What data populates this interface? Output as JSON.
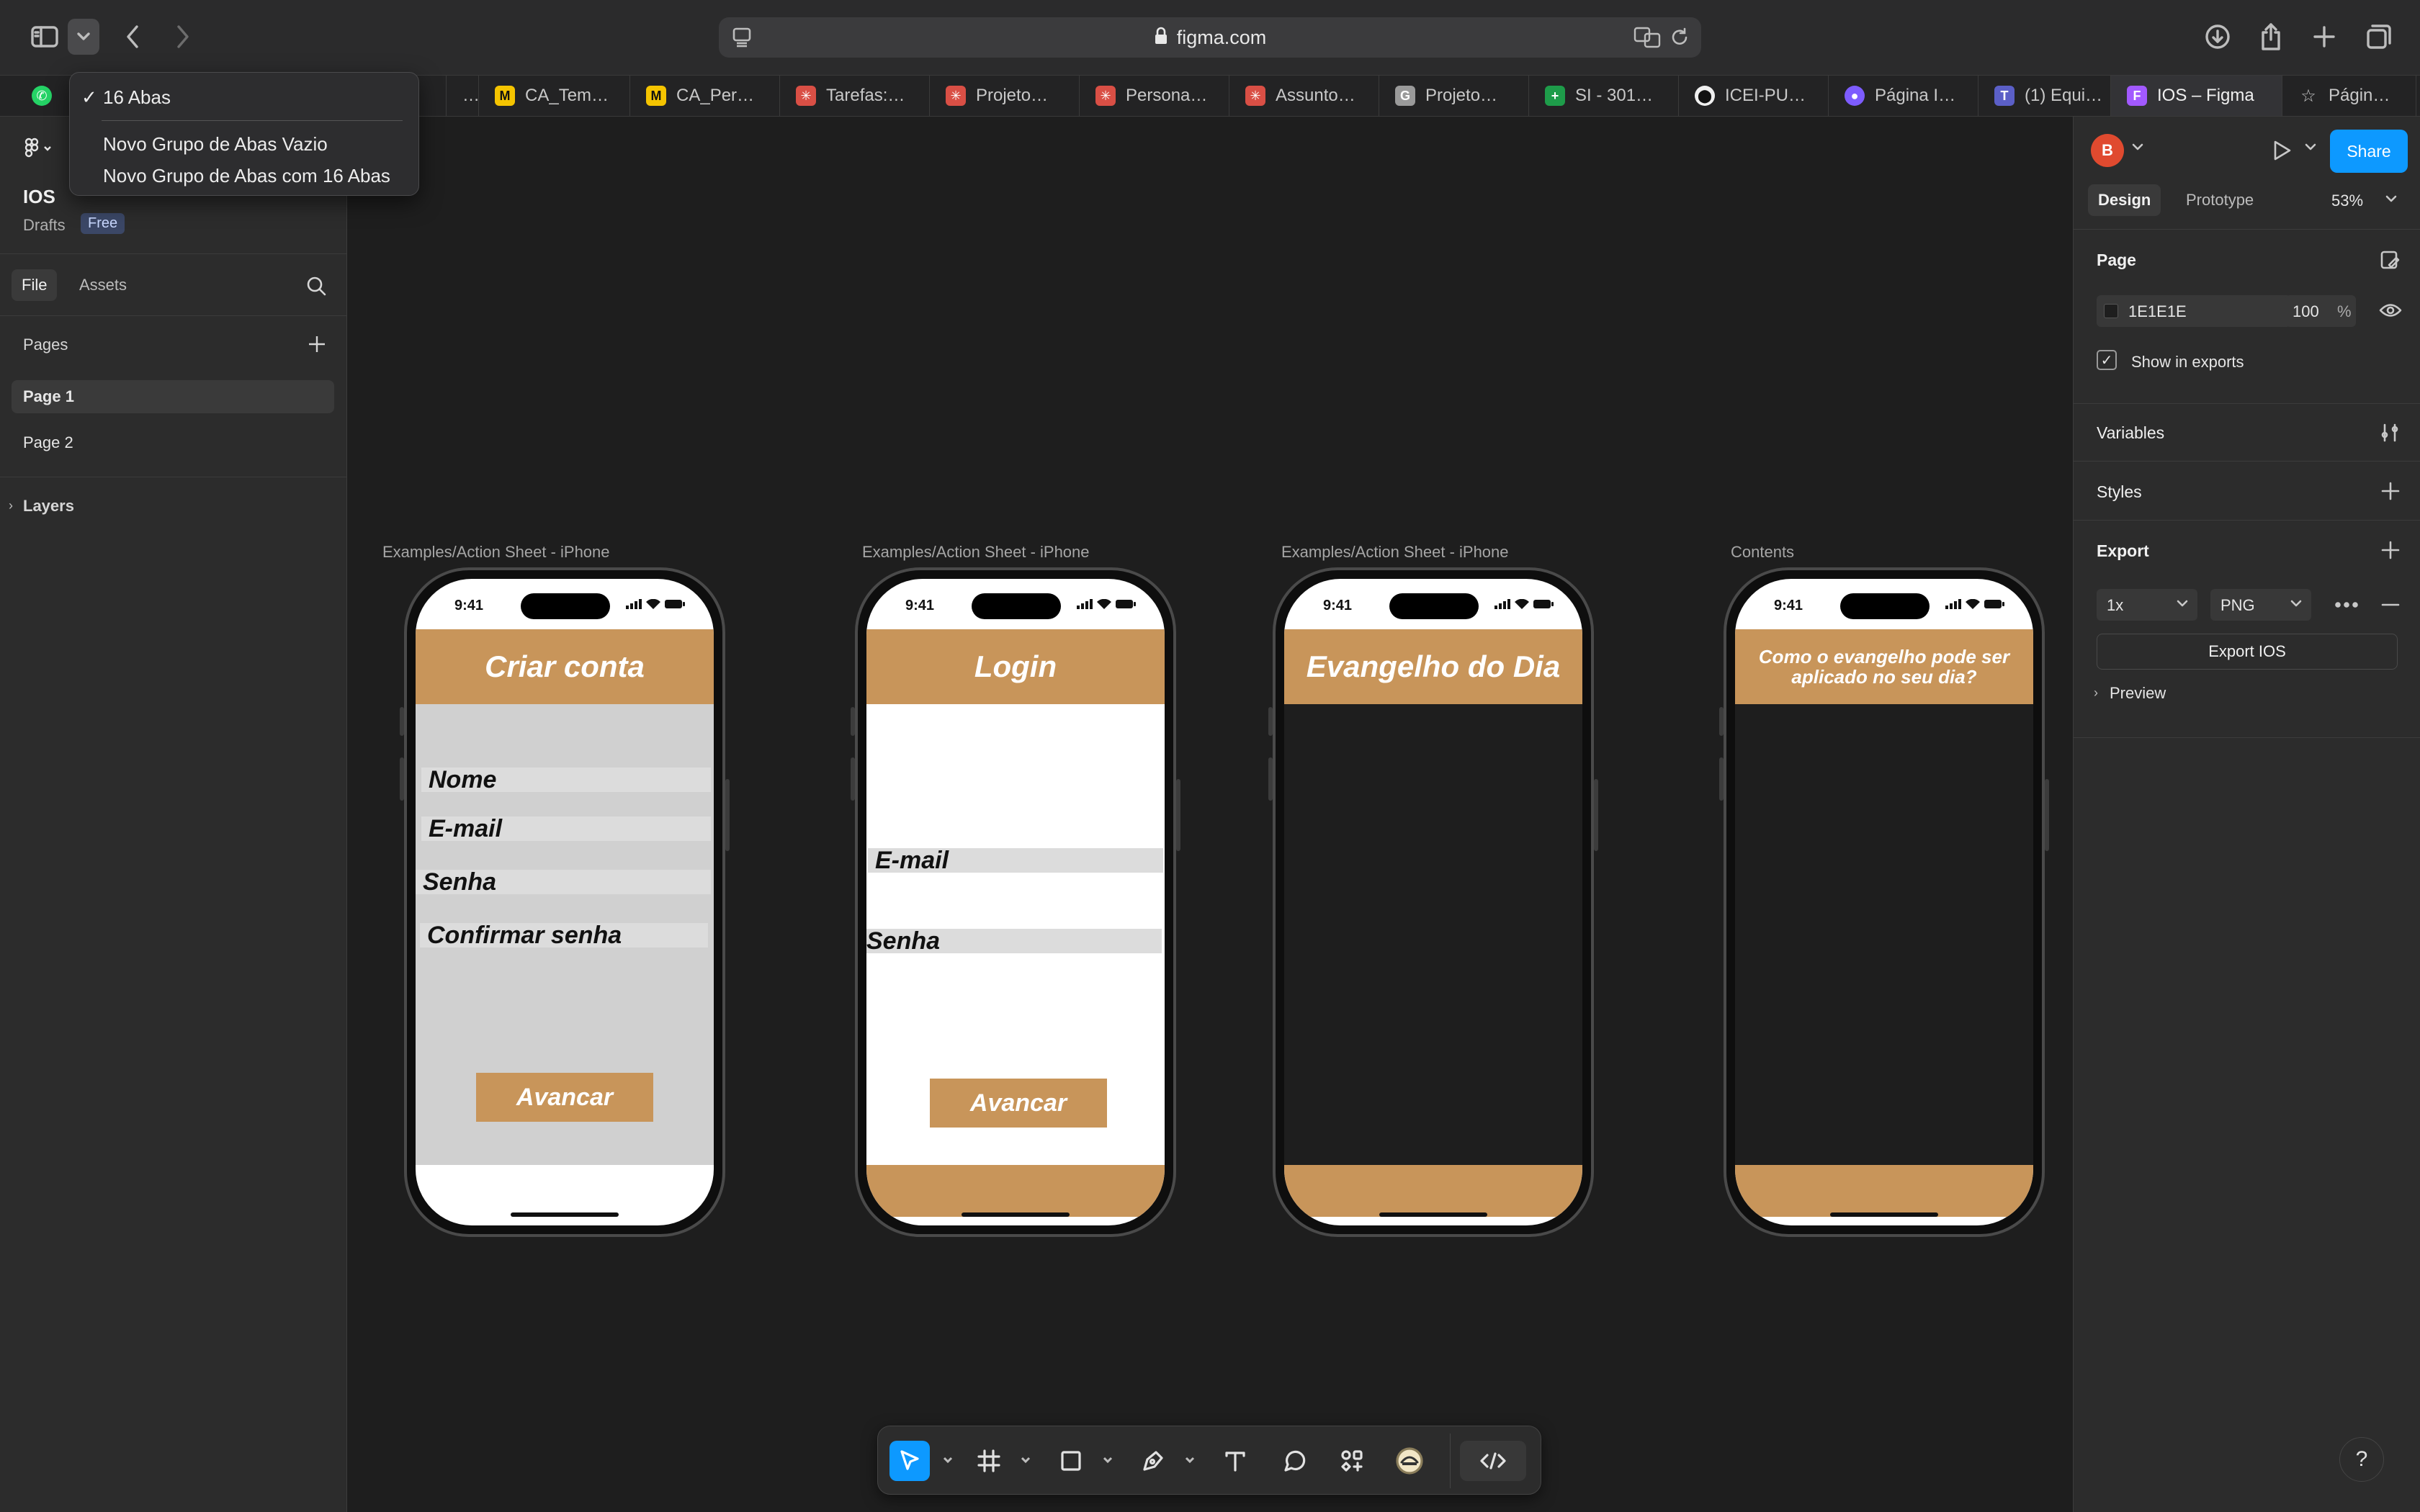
{
  "browser": {
    "url": "figma.com",
    "tabs": [
      {
        "title": "…",
        "fav": "",
        "color": "#2a2a2a"
      },
      {
        "title": "CA_Tem…",
        "fav": "M",
        "color": "#f5c400"
      },
      {
        "title": "CA_Per…",
        "fav": "M",
        "color": "#f5c400"
      },
      {
        "title": "Tarefas:…",
        "fav": "✳",
        "color": "#d94f45"
      },
      {
        "title": "Projeto…",
        "fav": "✳",
        "color": "#d94f45"
      },
      {
        "title": "Persona…",
        "fav": "✳",
        "color": "#d94f45"
      },
      {
        "title": "Assunto…",
        "fav": "✳",
        "color": "#d94f45"
      },
      {
        "title": "Projeto…",
        "fav": "G",
        "color": "#9a9a9a"
      },
      {
        "title": "SI - 301…",
        "fav": "+",
        "color": "#1e9c4a"
      },
      {
        "title": "ICEI-PU…",
        "fav": "⬤",
        "color": "#f0f0f0"
      },
      {
        "title": "Página I…",
        "fav": "●",
        "color": "#7d5cff"
      },
      {
        "title": "(1) Equi…",
        "fav": "T",
        "color": "#5b5fc7"
      },
      {
        "title": "IOS – Figma",
        "fav": "F",
        "color": "#a259ff"
      },
      {
        "title": "Págin…",
        "fav": "☆",
        "color": "#2a2a2a"
      }
    ]
  },
  "tab_menu": {
    "current": "16 Abas",
    "items": [
      "Novo Grupo de Abas Vazio",
      "Novo Grupo de Abas com 16 Abas"
    ]
  },
  "file": {
    "title": "IOS",
    "location": "Drafts",
    "plan": "Free",
    "tabs": [
      "File",
      "Assets"
    ],
    "pages_heading": "Pages",
    "pages": [
      "Page 1",
      "Page 2"
    ],
    "layers_heading": "Layers"
  },
  "right": {
    "avatar": "B",
    "share": "Share",
    "tabs": [
      "Design",
      "Prototype"
    ],
    "zoom": "53%",
    "page_heading": "Page",
    "page_color": "1E1E1E",
    "page_opacity": "100",
    "percent": "%",
    "show_exports": "Show in exports",
    "variables": "Variables",
    "styles": "Styles",
    "export": "Export",
    "scale": "1x",
    "format": "PNG",
    "export_button": "Export IOS",
    "preview": "Preview"
  },
  "frames": [
    {
      "label": "Examples/Action Sheet - iPhone",
      "time": "9:41",
      "header": "Criar conta",
      "fields": [
        "Nome",
        "E-mail",
        "Senha",
        "Confirmar senha"
      ],
      "button": "Avancar"
    },
    {
      "label": "Examples/Action Sheet - iPhone",
      "time": "9:41",
      "header": "Login",
      "fields": [
        "E-mail",
        "Senha"
      ],
      "button": "Avancar"
    },
    {
      "label": "Examples/Action Sheet - iPhone",
      "time": "9:41",
      "header": "Evangelho do Dia"
    },
    {
      "label": "Contents",
      "time": "9:41",
      "header": "Como o evangelho pode ser aplicado no seu dia?"
    }
  ],
  "colors": {
    "accent": "#c8955a",
    "figma_blue": "#0d99ff",
    "canvas": "#1e1e1e"
  }
}
